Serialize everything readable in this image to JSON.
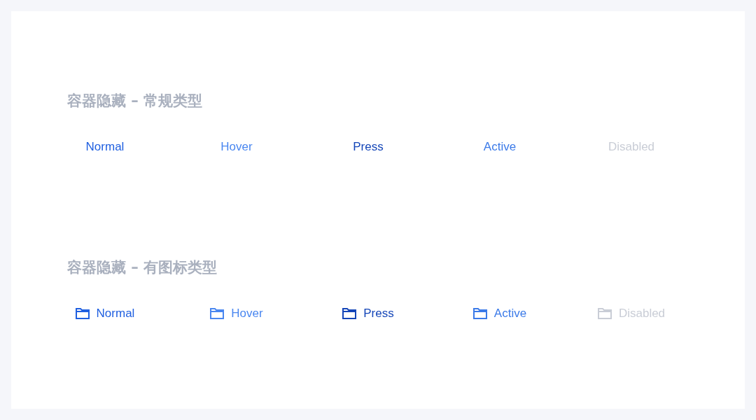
{
  "sections": [
    {
      "title": "容器隐藏 – 常规类型",
      "kind": "text",
      "items": [
        {
          "label": "Normal",
          "kind": "normal"
        },
        {
          "label": "Hover",
          "kind": "hover"
        },
        {
          "label": "Press",
          "kind": "press"
        },
        {
          "label": "Active",
          "kind": "active"
        },
        {
          "label": "Disabled",
          "kind": "disabled"
        }
      ]
    },
    {
      "title": "容器隐藏 – 有图标类型",
      "kind": "icon",
      "items": [
        {
          "label": "Normal",
          "kind": "normal"
        },
        {
          "label": "Hover",
          "kind": "hover"
        },
        {
          "label": "Press",
          "kind": "press"
        },
        {
          "label": "Active",
          "kind": "active"
        },
        {
          "label": "Disabled",
          "kind": "disabled"
        }
      ]
    }
  ]
}
